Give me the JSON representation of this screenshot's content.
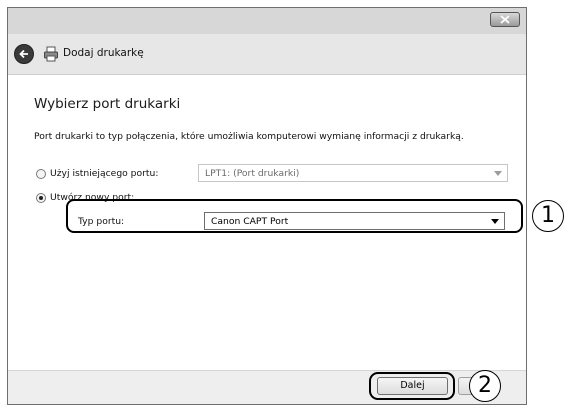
{
  "window": {
    "title": "Dodaj drukarkę",
    "close_icon": "close-icon"
  },
  "page": {
    "heading": "Wybierz port drukarki",
    "description": "Port drukarki to typ połączenia, które umożliwia komputerowi wymianę informacji z drukarką."
  },
  "options": {
    "existing_label": "Użyj istniejącego portu:",
    "existing_value": "LPT1: (Port drukarki)",
    "existing_selected": false,
    "new_label": "Utwórz nowy port:",
    "new_selected": true,
    "type_label": "Typ portu:",
    "type_value": "Canon CAPT Port"
  },
  "footer": {
    "next_label": "Dalej"
  },
  "callouts": [
    "1",
    "2"
  ]
}
